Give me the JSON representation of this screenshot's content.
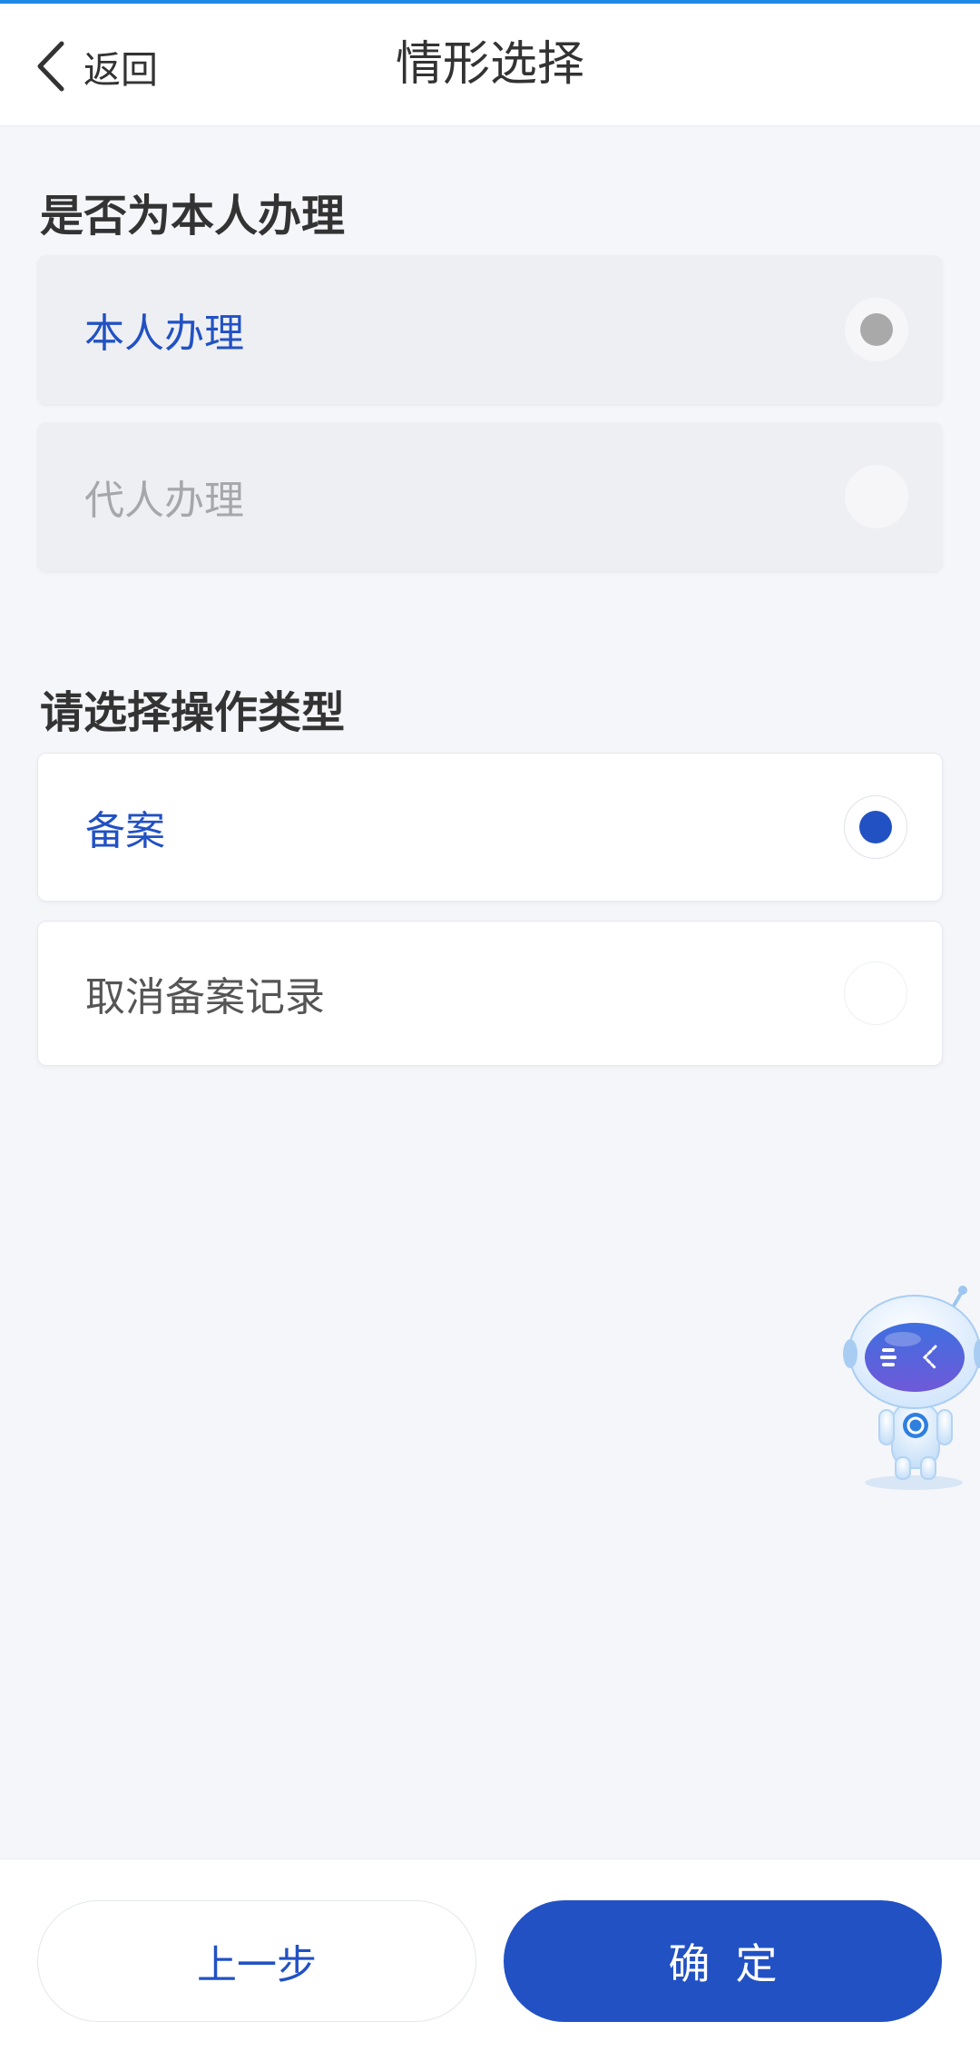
{
  "header": {
    "back_label": "返回",
    "title": "情形选择"
  },
  "section_applicant": {
    "title": "是否为本人办理",
    "options": [
      {
        "label": "本人办理",
        "selected": true,
        "disabled": true
      },
      {
        "label": "代人办理",
        "selected": false,
        "disabled": true
      }
    ]
  },
  "section_operation": {
    "title": "请选择操作类型",
    "options": [
      {
        "label": "备案",
        "selected": true,
        "disabled": false
      },
      {
        "label": "取消备案记录",
        "selected": false,
        "disabled": false
      }
    ]
  },
  "footer": {
    "prev_label": "上一步",
    "confirm_label": "确定"
  },
  "colors": {
    "accent": "#2151c3",
    "top_bar": "#1e88e5",
    "background": "#f5f6fa"
  },
  "icons": {
    "back": "chevron-left-icon",
    "assistant": "robot-assistant-icon"
  }
}
